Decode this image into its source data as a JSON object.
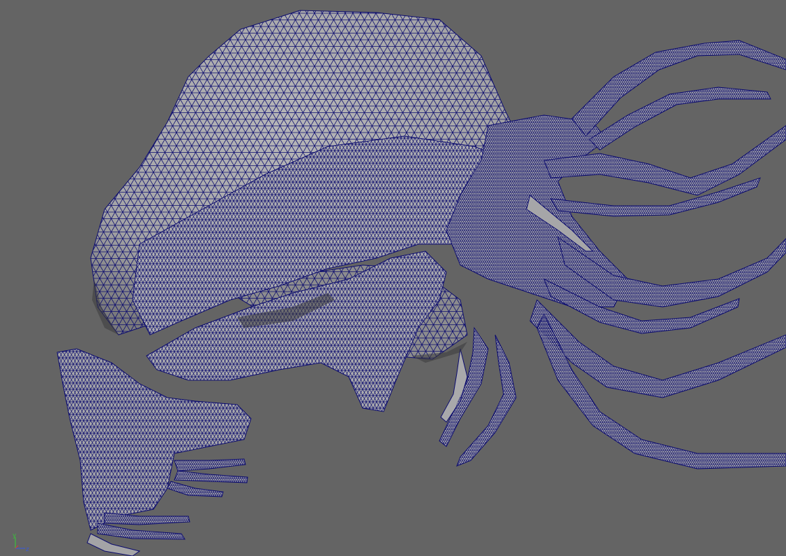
{
  "viewport": {
    "background_color": "#646464",
    "mesh_fill_color": "#a9a9ab",
    "mesh_shadow_color": "#7e7e80",
    "wire_color": "#0c0c6e",
    "display_mode": "wireframe-on-shaded"
  },
  "axis_gizmo": {
    "y_label": "y",
    "z_label": "z",
    "x_color": "#d23c3c",
    "y_color": "#3cbd3c",
    "z_color": "#3c5ad2"
  }
}
